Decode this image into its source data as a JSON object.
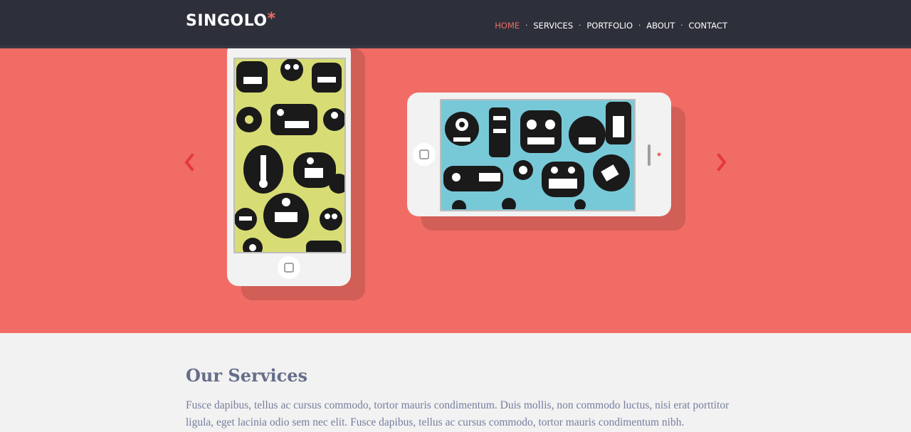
{
  "header": {
    "logo_text": "SINGOLO",
    "logo_star": "*",
    "nav": [
      {
        "label": "HOME",
        "active": true
      },
      {
        "label": "SERVICES",
        "active": false
      },
      {
        "label": "PORTFOLIO",
        "active": false
      },
      {
        "label": "ABOUT",
        "active": false
      },
      {
        "label": "CONTACT",
        "active": false
      }
    ],
    "separator": "·"
  },
  "slider": {
    "background_color": "#f06c64",
    "arrow_color": "#e5383a",
    "phone_vertical_screen_color": "#d8dc74",
    "phone_horizontal_screen_color": "#78c9d8",
    "left_icon": "chevron-left-icon",
    "right_icon": "chevron-right-icon"
  },
  "services": {
    "title": "Our Services",
    "description": "Fusce dapibus, tellus ac cursus commodo, tortor mauris condimentum. Duis mollis, non commodo luctus, nisi erat porttitor ligula, eget lacinia odio sem nec elit. Fusce dapibus, tellus ac cursus commodo, tortor mauris condimentum nibh."
  },
  "colors": {
    "header_bg": "#2d303a",
    "accent": "#f06c64",
    "text_muted": "#767e9e"
  }
}
